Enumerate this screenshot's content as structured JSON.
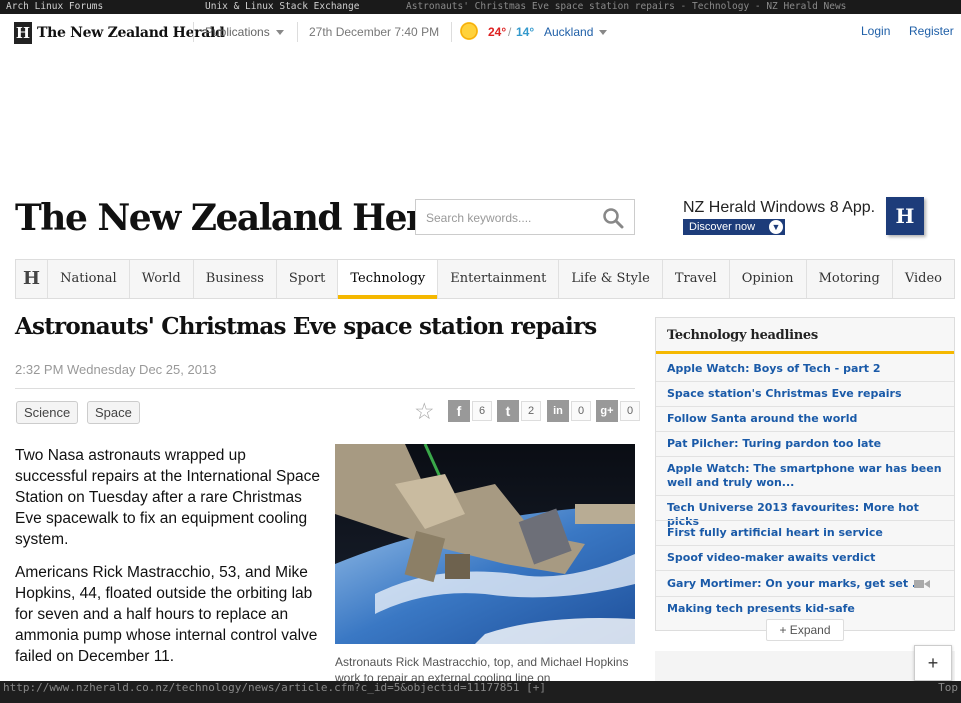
{
  "browser": {
    "tabs": [
      "Arch Linux Forums",
      "Unix & Linux Stack Exchange",
      "Astronauts' Christmas Eve space station repairs - Technology - NZ Herald News"
    ],
    "status_url": "http://www.nzherald.co.nz/technology/news/article.cfm?c_id=5&objectid=11177851 [+]",
    "status_right": "Top"
  },
  "util_bar": {
    "logo_mark": "H",
    "site_name": "The New Zealand Herald",
    "publications": "Publications",
    "datetime": "27th December 7:40 PM",
    "temp_high": "24°",
    "temp_sep": "/",
    "temp_low": "14°",
    "city": "Auckland",
    "login": "Login",
    "register": "Register"
  },
  "masthead": {
    "title": "The New Zealand Herald",
    "search_placeholder": "Search keywords....",
    "promo_title": "NZ Herald Windows 8 App.",
    "promo_button": "Discover now",
    "promo_logo": "H"
  },
  "nav": {
    "home_mark": "H",
    "items": [
      "National",
      "World",
      "Business",
      "Sport",
      "Technology",
      "Entertainment",
      "Life & Style",
      "Travel",
      "Opinion",
      "Motoring",
      "Video"
    ],
    "active": "Technology"
  },
  "article": {
    "headline": "Astronauts' Christmas Eve space station repairs",
    "timestamp": "2:32 PM Wednesday Dec 25, 2013",
    "tags": [
      "Science",
      "Space"
    ],
    "shares": [
      {
        "icon": "facebook-icon",
        "glyph": "f",
        "count": "6"
      },
      {
        "icon": "twitter-icon",
        "glyph": "t",
        "count": "2"
      },
      {
        "icon": "linkedin-icon",
        "glyph": "in",
        "count": "0"
      },
      {
        "icon": "googleplus-icon",
        "glyph": "g+",
        "count": "0"
      }
    ],
    "paragraphs": [
      "Two Nasa astronauts wrapped up successful repairs at the International Space Station on Tuesday after a rare Christmas Eve spacewalk to fix an equipment cooling system.",
      "Americans Rick Mastracchio, 53, and Mike Hopkins, 44, floated outside the orbiting lab for seven and a half hours to replace an ammonia pump whose internal control valve failed on December 11."
    ],
    "caption": "Astronauts Rick Mastracchio, top, and Michael Hopkins work to repair an external cooling line on"
  },
  "sidebar": {
    "heading": "Technology headlines",
    "headlines": [
      "Apple Watch: Boys of Tech - part 2",
      "Space station's Christmas Eve repairs",
      "Follow Santa around the world",
      "Pat Pilcher: Turing pardon too late",
      "Apple Watch: The smartphone war has been well and truly won...",
      "Tech Universe 2013 favourites: More hot picks",
      "First fully artificial heart in service",
      "Spoof video-maker awaits verdict",
      "Gary Mortimer: On your marks, get set ...",
      "Making tech presents kid-safe"
    ],
    "expand": "+ Expand",
    "plus": "+"
  },
  "colors": {
    "accent": "#f5b800",
    "link": "#1a5aa8",
    "promo": "#1d3c7a"
  }
}
